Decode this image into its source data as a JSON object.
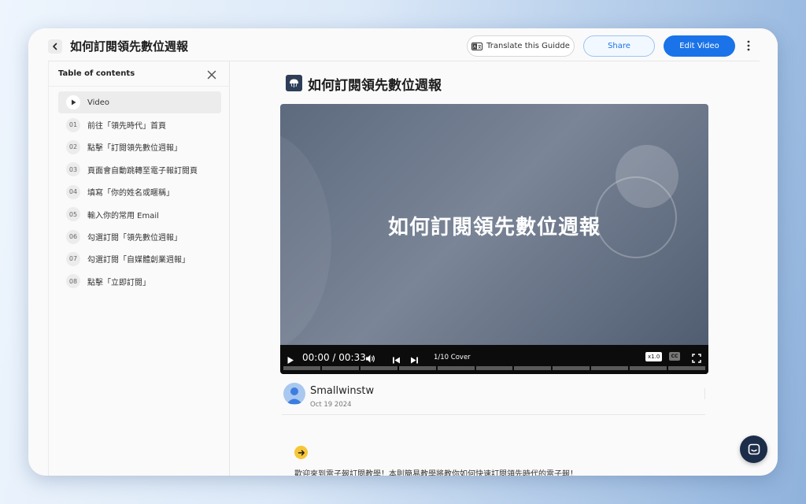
{
  "header": {
    "title": "如何訂閱領先數位週報",
    "translate_label": "Translate this Guidde",
    "share_label": "Share",
    "edit_label": "Edit Video"
  },
  "toc": {
    "title": "Table of contents",
    "items": [
      {
        "num": "",
        "label": "Video"
      },
      {
        "num": "01",
        "label": "前往「領先時代」首頁"
      },
      {
        "num": "02",
        "label": "點擊「訂閱領先數位週報」"
      },
      {
        "num": "03",
        "label": "頁面會自動跳轉至電子報訂閱頁"
      },
      {
        "num": "04",
        "label": "填寫「你的姓名或暱稱」"
      },
      {
        "num": "05",
        "label": "輸入你的常用 Email"
      },
      {
        "num": "06",
        "label": "勾選訂閱「領先數位週報」"
      },
      {
        "num": "07",
        "label": "勾選訂閱「自媒體創業週報」"
      },
      {
        "num": "08",
        "label": "點擊「立即訂閱」"
      }
    ]
  },
  "main": {
    "title": "如何訂閱領先數位週報",
    "video": {
      "title": "如何訂閱領先數位週報",
      "time": "00:00 / 00:33",
      "chapter": "1/10 Cover",
      "speed": "x1.0",
      "cc": "CC",
      "progress_segments": 11
    },
    "author": {
      "name": "Smallwinstw",
      "date": "Oct 19 2024"
    },
    "intro": "歡迎來到電子報訂閱教學！本則簡易教學將教你如何快速訂閱領先時代的電子報！"
  },
  "colors": {
    "accent": "#1a73e8",
    "intro_icon": "#f7c638",
    "chat_button": "#1c2d4a"
  },
  "icons": {
    "back": "chevron-left-icon",
    "translate": "translate-icon",
    "more": "vertical-dots-icon",
    "close": "close-icon",
    "play": "play-icon",
    "volume": "volume-icon",
    "prev": "skip-previous-icon",
    "next": "skip-next-icon",
    "fullscreen": "fullscreen-icon",
    "intro": "arrow-right-icon",
    "chat": "chat-icon"
  }
}
